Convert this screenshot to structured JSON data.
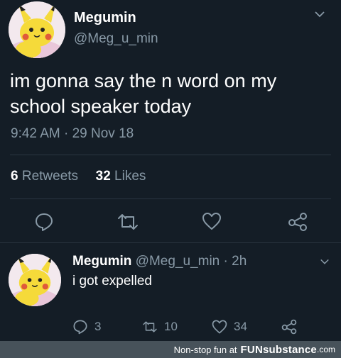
{
  "main_tweet": {
    "display_name": "Megumin",
    "handle": "@Meg_u_min",
    "text": "im gonna say the n word on my school speaker today",
    "timestamp": "9:42 AM · 29 Nov 18",
    "retweets_count": "6",
    "retweets_label": "Retweets",
    "likes_count": "32",
    "likes_label": "Likes",
    "actions": [
      "reply-icon",
      "retweet-icon",
      "like-icon",
      "share-icon"
    ]
  },
  "reply": {
    "display_name": "Megumin",
    "meta": "@Meg_u_min · 2h",
    "text": "i got expelled",
    "reply_count": "3",
    "retweet_count": "10",
    "like_count": "34"
  },
  "footer": {
    "tagline": "Non-stop fun at",
    "brand": "FUNsubstance",
    "domain": ".com"
  },
  "colors": {
    "background": "#141d26",
    "secondary_text": "#8899a6",
    "divider": "#2a3541",
    "footer_bg": "#47525a"
  }
}
